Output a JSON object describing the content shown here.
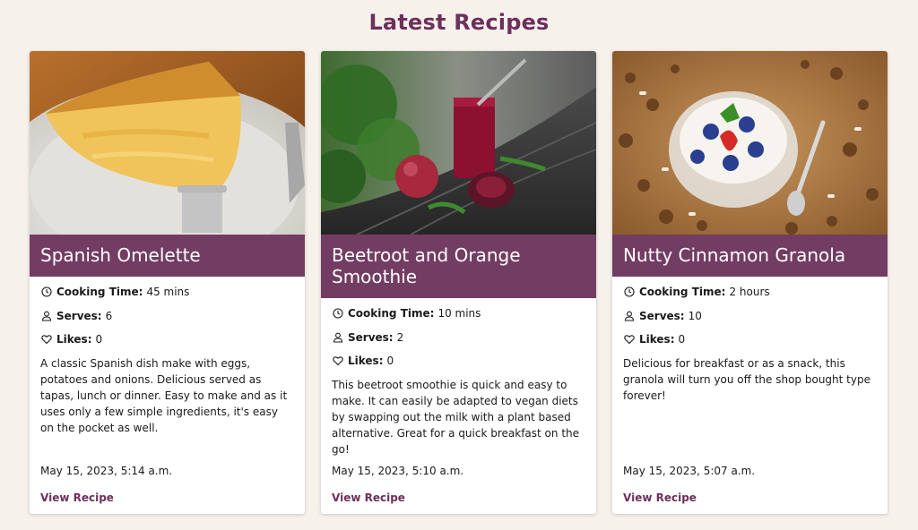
{
  "page": {
    "title": "Latest Recipes"
  },
  "labels": {
    "cooking_time": "Cooking Time:",
    "serves": "Serves:",
    "likes": "Likes:",
    "view_recipe": "View Recipe"
  },
  "icons": {
    "clock": "clock-icon",
    "person": "person-icon",
    "heart": "heart-icon"
  },
  "colors": {
    "accent": "#733c63",
    "heading": "#6d2f5b",
    "background": "#f7f1ec",
    "card": "#ffffff"
  },
  "recipes": [
    {
      "title": "Spanish Omelette",
      "image_alt": "Spanish omelette slice on a plate with fork and knife",
      "cooking_time": "45 mins",
      "serves": "6",
      "likes": "0",
      "description": "A classic Spanish dish make with eggs, potatoes and onions. Delicious served as tapas, lunch or dinner. Easy to make and as it uses only a few simple ingredients, it's easy on the pocket as well.",
      "date": "May 15, 2023, 5:14 a.m."
    },
    {
      "title": "Beetroot and Orange Smoothie",
      "image_alt": "Red smoothie in a glass with apple and beetroot on a table",
      "cooking_time": "10 mins",
      "serves": "2",
      "likes": "0",
      "description": "This beetroot smoothie is quick and easy to make. It can easily be adapted to vegan diets by swapping out the milk with a plant based alternative. Great for a quick breakfast on the go!",
      "date": "May 15, 2023, 5:10 a.m."
    },
    {
      "title": "Nutty Cinnamon Granola",
      "image_alt": "Bowl of yogurt with berries surrounded by granola",
      "cooking_time": "2 hours",
      "serves": "10",
      "likes": "0",
      "description": "Delicious for breakfast or as a snack, this granola will turn you off the shop bought type forever!",
      "date": "May 15, 2023, 5:07 a.m."
    }
  ]
}
